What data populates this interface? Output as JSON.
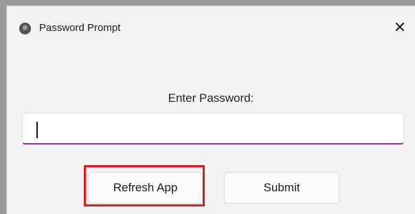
{
  "window": {
    "title": "Password Prompt",
    "close_label": "✕"
  },
  "dialog": {
    "prompt_label": "Enter Password:",
    "password_value": "",
    "refresh_label": "Refresh App",
    "submit_label": "Submit"
  },
  "colors": {
    "input_underline": "#8a2aa8",
    "highlight_box": "#e3171d"
  },
  "icons": {
    "app_icon": "app-icon",
    "close_icon": "close-icon"
  }
}
